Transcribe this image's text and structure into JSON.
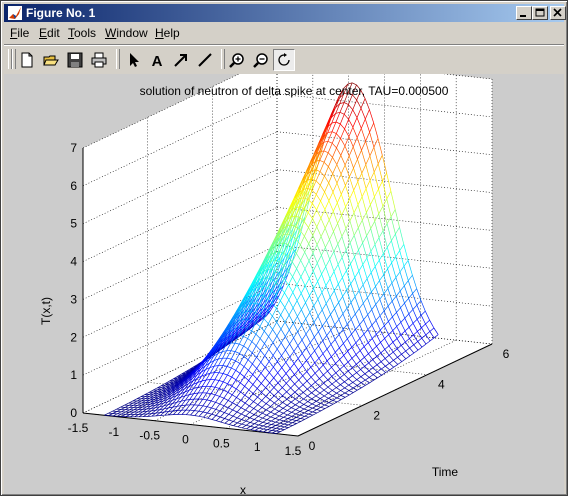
{
  "window": {
    "title": "Figure No. 1",
    "buttons": {
      "minimize": "minimize",
      "maximize": "maximize",
      "close": "close"
    }
  },
  "menu": {
    "items": [
      {
        "label": "File",
        "accel": "F"
      },
      {
        "label": "Edit",
        "accel": "E"
      },
      {
        "label": "Tools",
        "accel": "T"
      },
      {
        "label": "Window",
        "accel": "W"
      },
      {
        "label": "Help",
        "accel": "H"
      }
    ]
  },
  "toolbar": {
    "icons": [
      "new-file-icon",
      "open-folder-icon",
      "save-icon",
      "print-icon",
      "select-arrow-icon",
      "insert-text-icon",
      "insert-arrow-icon",
      "insert-line-icon",
      "zoom-in-icon",
      "zoom-out-icon",
      "rotate-3d-icon"
    ],
    "insert_text_glyph": "A",
    "pressed": "rotate-3d-icon"
  },
  "colors": {
    "title_bar_start": "#0a246a",
    "title_bar_end": "#a6caf0",
    "figure_background": "#cccccc",
    "axes_background": "#ffffff"
  },
  "chart_data": {
    "type": "surface",
    "title": "solution of neutron of delta spike at center, TAU=0.000500",
    "xlabel": "x",
    "ylabel": "Time",
    "zlabel": "T(x,t)",
    "xlim": [
      -1.5,
      1.5
    ],
    "ylim": [
      0,
      6
    ],
    "zlim": [
      0,
      7
    ],
    "x_ticks": [
      "-1.5",
      "-1",
      "-0.5",
      "0",
      "0.5",
      "1",
      "1.5"
    ],
    "y_ticks": [
      "0",
      "2",
      "4",
      "6"
    ],
    "z_ticks": [
      "0",
      "1",
      "2",
      "3",
      "4",
      "5",
      "6",
      "7"
    ],
    "grid": true,
    "colormap": "jet",
    "surface": {
      "x_range": [
        -1.2,
        1.2
      ],
      "time_range": [
        0,
        5
      ],
      "peak_value": 7.0,
      "peak_location": {
        "x": 0,
        "time": 5
      }
    }
  }
}
